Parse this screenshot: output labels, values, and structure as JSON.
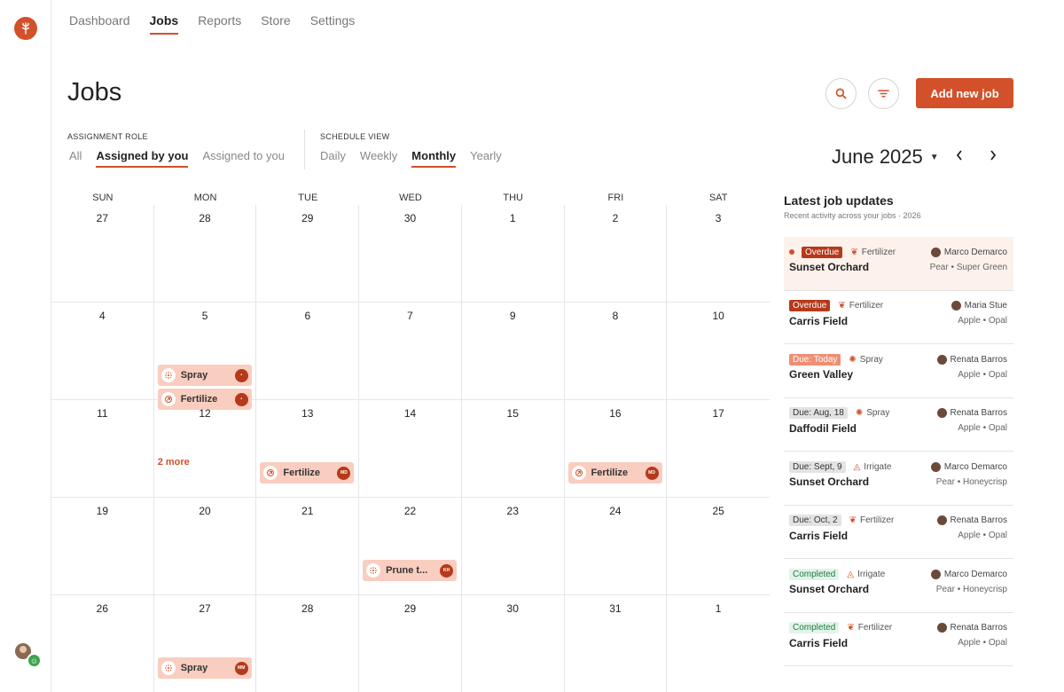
{
  "nav": {
    "items": [
      {
        "label": "Dashboard",
        "active": false
      },
      {
        "label": "Jobs",
        "active": true
      },
      {
        "label": "Reports",
        "active": false
      },
      {
        "label": "Store",
        "active": false
      },
      {
        "label": "Settings",
        "active": false
      }
    ]
  },
  "page": {
    "title": "Jobs",
    "add_button": "Add new job"
  },
  "assignment_role": {
    "label": "ASSIGNMENT ROLE",
    "options": [
      {
        "label": "All",
        "active": false
      },
      {
        "label": "Assigned by you",
        "active": true
      },
      {
        "label": "Assigned to you",
        "active": false
      }
    ]
  },
  "schedule_view": {
    "label": "SCHEDULE VIEW",
    "options": [
      {
        "label": "Daily",
        "active": false
      },
      {
        "label": "Weekly",
        "active": false
      },
      {
        "label": "Monthly",
        "active": true
      },
      {
        "label": "Yearly",
        "active": false
      }
    ]
  },
  "month": {
    "label": "June 2025"
  },
  "calendar": {
    "weekdays": [
      "SUN",
      "MON",
      "TUE",
      "WED",
      "THU",
      "FRI",
      "SAT"
    ],
    "days": [
      "27",
      "28",
      "29",
      "30",
      "1",
      "2",
      "3",
      "4",
      "5",
      "6",
      "7",
      "9",
      "8",
      "10",
      "11",
      "12",
      "13",
      "14",
      "15",
      "16",
      "17",
      "19",
      "20",
      "21",
      "22",
      "23",
      "24",
      "25",
      "26",
      "27",
      "28",
      "29",
      "30",
      "31",
      "1"
    ],
    "more_label": "2 more",
    "events": [
      {
        "cell": 8,
        "slot": 0,
        "label": "Spray",
        "type": "spray",
        "assignee": "•"
      },
      {
        "cell": 8,
        "slot": 1,
        "label": "Fertilize",
        "type": "fertilize",
        "assignee": "•"
      },
      {
        "cell": 12,
        "slot": 0,
        "label": "Fertilize",
        "type": "fertilize",
        "assignee": "MD"
      },
      {
        "cell": 16,
        "slot": 1,
        "label": "Fertilize",
        "type": "fertilize",
        "assignee": "MD"
      },
      {
        "cell": 24,
        "slot": 0,
        "label": "Prune t...",
        "type": "spray",
        "assignee": "KH"
      },
      {
        "cell": 29,
        "slot": 0,
        "label": "Spray",
        "type": "spray",
        "assignee": "MM"
      }
    ]
  },
  "updates": {
    "title": "Latest job updates",
    "subtitle": "Recent activity across your jobs · 2026",
    "items": [
      {
        "status": "Overdue",
        "kind": "overdue",
        "type": "Fertilizer",
        "person": "Marco Demarco",
        "field": "Sunset Orchard",
        "crop": "Pear • Super Green",
        "highlight": true,
        "unread": true
      },
      {
        "status": "Overdue",
        "kind": "overdue",
        "type": "Fertilizer",
        "person": "Maria Stue",
        "field": "Carris Field",
        "crop": "Apple • Opal",
        "highlight": false,
        "unread": false
      },
      {
        "status": "Due: Today",
        "kind": "today",
        "type": "Spray",
        "person": "Renata Barros",
        "field": "Green Valley",
        "crop": "Apple • Opal",
        "highlight": false,
        "unread": false
      },
      {
        "status": "Due: Aug, 18",
        "kind": "due",
        "type": "Spray",
        "person": "Renata Barros",
        "field": "Daffodil Field",
        "crop": "Apple • Opal",
        "highlight": false,
        "unread": false
      },
      {
        "status": "Due: Sept, 9",
        "kind": "due",
        "type": "Irrigate",
        "person": "Marco Demarco",
        "field": "Sunset Orchard",
        "crop": "Pear • Honeycrisp",
        "highlight": false,
        "unread": false
      },
      {
        "status": "Due: Oct, 2",
        "kind": "due",
        "type": "Fertilizer",
        "person": "Renata Barros",
        "field": "Carris Field",
        "crop": "Apple • Opal",
        "highlight": false,
        "unread": false
      },
      {
        "status": "Completed",
        "kind": "done",
        "type": "Irrigate",
        "person": "Marco Demarco",
        "field": "Sunset Orchard",
        "crop": "Pear • Honeycrisp",
        "highlight": false,
        "unread": false
      },
      {
        "status": "Completed",
        "kind": "done",
        "type": "Fertilizer",
        "person": "Renata Barros",
        "field": "Carris Field",
        "crop": "Apple • Opal",
        "highlight": false,
        "unread": false
      }
    ]
  },
  "colors": {
    "accent": "#d2502a",
    "event_bg": "#f9cdbf",
    "overdue": "#b5391a",
    "today": "#f08e73",
    "completed": "#1f7a45"
  },
  "icons": {
    "spray": "spray-icon",
    "fertilize": "fertilize-icon",
    "fertilizer": "fertilizer-icon",
    "irrigate": "irrigate-icon"
  }
}
